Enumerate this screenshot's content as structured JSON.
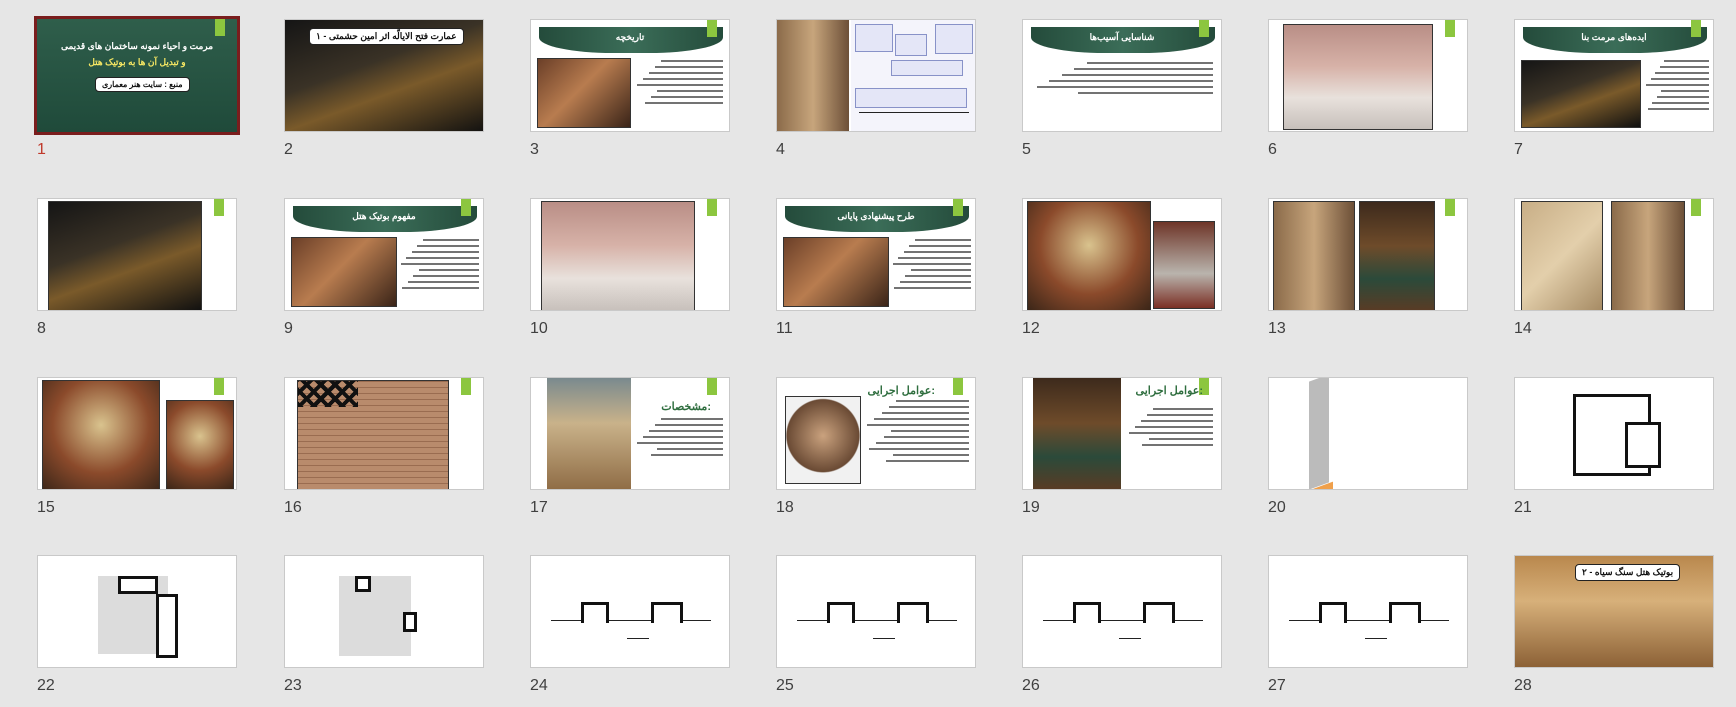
{
  "app": {
    "view": "Slide Sorter",
    "selected_slide": "1"
  },
  "slides": [
    {
      "number": "1",
      "title_line1": "مرمت و احیاء نمونه ساختمان های قدیمی",
      "title_line2": "و تبدیل آن ها به بوتیک هتل",
      "source_label": "منبع : سایت هنر معماری"
    },
    {
      "number": "2",
      "label": "۱ - عمارت فتح الایالّه اثر امین حشمتی"
    },
    {
      "number": "3",
      "title": "تاریخچه"
    },
    {
      "number": "4"
    },
    {
      "number": "5",
      "title": "شناسایی آسیب‌ها"
    },
    {
      "number": "6"
    },
    {
      "number": "7",
      "title": "ایده‌های مرمت بنا"
    },
    {
      "number": "8"
    },
    {
      "number": "9",
      "title": "مفهوم بوتیک هتل"
    },
    {
      "number": "10"
    },
    {
      "number": "11",
      "title": "طرح پیشنهادی پایانی"
    },
    {
      "number": "12"
    },
    {
      "number": "13"
    },
    {
      "number": "14"
    },
    {
      "number": "15"
    },
    {
      "number": "16"
    },
    {
      "number": "17",
      "title": "مشخصات:"
    },
    {
      "number": "18",
      "title": "عوامل اجرایی:"
    },
    {
      "number": "19",
      "title": "عوامل اجرایی:"
    },
    {
      "number": "20"
    },
    {
      "number": "21"
    },
    {
      "number": "22"
    },
    {
      "number": "23"
    },
    {
      "number": "24"
    },
    {
      "number": "25"
    },
    {
      "number": "26"
    },
    {
      "number": "27"
    },
    {
      "number": "28",
      "label": "۲ - بوتیک هتل سنگ سیاه"
    }
  ],
  "colors": {
    "selection_border": "#7a1d1d",
    "selected_number": "#c0392b",
    "accent": "#8cc63f",
    "title_band": "#2f5e4b"
  }
}
